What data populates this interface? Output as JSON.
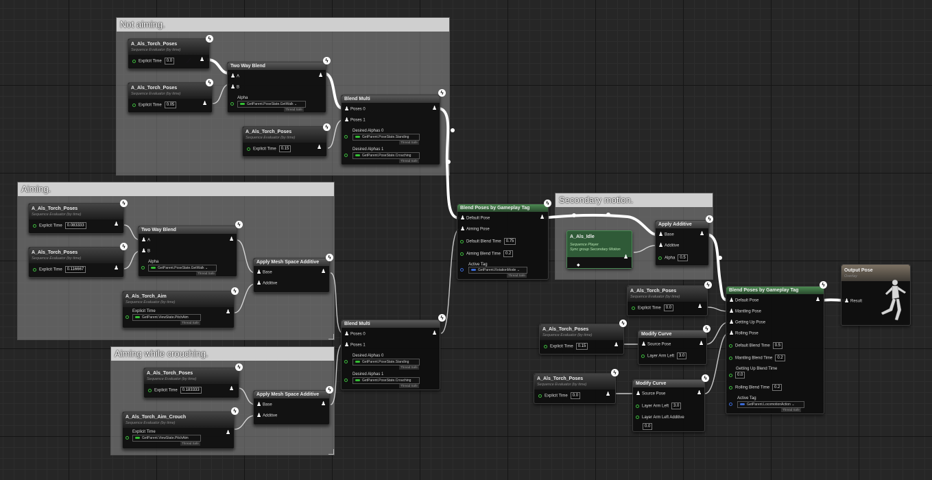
{
  "comments": {
    "not_aiming": "Not aiming.",
    "aiming": "Aiming.",
    "aiming_crouching": "Aiming while crouching.",
    "secondary_motion": "Secondary motion."
  },
  "common": {
    "sequence_evaluator": "Sequence Evaluator (by time)",
    "explicit_time": "Explicit Time",
    "thread_safe": "Thread Safe",
    "two_way_blend": "Two Way Blend",
    "blend_multi": "Blend Multi",
    "apply_mesh_space_additive": "Apply Mesh Space Additive",
    "apply_additive": "Apply Additive",
    "modify_curve": "Modify Curve",
    "blend_poses_by_gameplay_tag": "Blend Poses by Gameplay Tag",
    "pin_a": "A",
    "pin_b": "B",
    "pin_alpha": "Alpha",
    "pin_poses0": "Poses 0",
    "pin_poses1": "Poses 1",
    "pin_desired_alphas0": "Desired Alphas 0",
    "pin_desired_alphas1": "Desired Alphas 1",
    "pin_base": "Base",
    "pin_additive": "Additive",
    "pin_source_pose": "Source Pose",
    "pin_layer_arm_left": "Layer Arm Left",
    "pin_layer_arm_left_additive": "Layer Arm Left Additive",
    "pin_active_tag": "Active Tag",
    "pin_result": "Result"
  },
  "anims": {
    "torch_poses": "A_Als_Torch_Poses",
    "torch_aim": "A_Als_Torch_Aim",
    "torch_aim_crouch": "A_Als_Torch_Aim_Crouch",
    "idle": "A_Als_Idle"
  },
  "values": {
    "na_t1": "0.0",
    "na_t2": "0.05",
    "na_t3": "0.15",
    "a_t1": "0.083333",
    "a_t2": "0.116667",
    "c_t1": "0.183333",
    "sec_alpha": "0.5",
    "mid_default_blend": "0.75",
    "mid_aiming_blend": "0.2",
    "r_t1": "0.0",
    "r_t2": "0.15",
    "r_t3": "0.0",
    "mc1_layer": "3.0",
    "mc2_layer": "3.0",
    "mc2_additive": "0.0",
    "r_default_blend": "0.5",
    "r_mantling_blend": "0.2",
    "r_getting_up_blend": "0.0",
    "r_rolling_blend": "0.2"
  },
  "bindings": {
    "get_walk": "GetParent.PoseState.GetWalk",
    "standing": "GetParent.PoseState.Standing",
    "crouching": "GetParent.PoseState.Crouching",
    "pitch_aim": "GetParent.ViewState.PitchAim",
    "rotation_mode": "GetParent.RotationMode",
    "locomotion_action": "GetParent.LocomotionAction"
  },
  "idle_node": {
    "sub1": "Sequence Player",
    "sub2": "Sync group Secondary Motion"
  },
  "mid_blend": {
    "default_pose": "Default Pose",
    "aiming_pose": "Aiming Pose",
    "default_blend_time": "Default Blend Time",
    "aiming_blend_time": "Aiming Blend Time"
  },
  "right_blend": {
    "default_pose": "Default Pose",
    "mantling_pose": "Mantling Pose",
    "getting_up_pose": "Getting Up Pose",
    "rolling_pose": "Rolling Pose",
    "default_blend_time": "Default Blend Time",
    "mantling_blend_time": "Mantling Blend Time",
    "getting_up_blend_time": "Getting Up Blend Time",
    "rolling_blend_time": "Rolling Blend Time"
  },
  "output": {
    "title": "Output Pose",
    "sub": "Overlay"
  },
  "colors": {
    "wire": "#ffffff",
    "pose_pin": "#ffffff",
    "float_pin": "#3dbd3d",
    "tag_pin": "#3a6ad8",
    "comment_title": "#cfcfcf",
    "node_green": "#4b8a52"
  },
  "icons": {
    "bolt": "lightning-icon",
    "pose": "pose-mannequin-icon"
  }
}
